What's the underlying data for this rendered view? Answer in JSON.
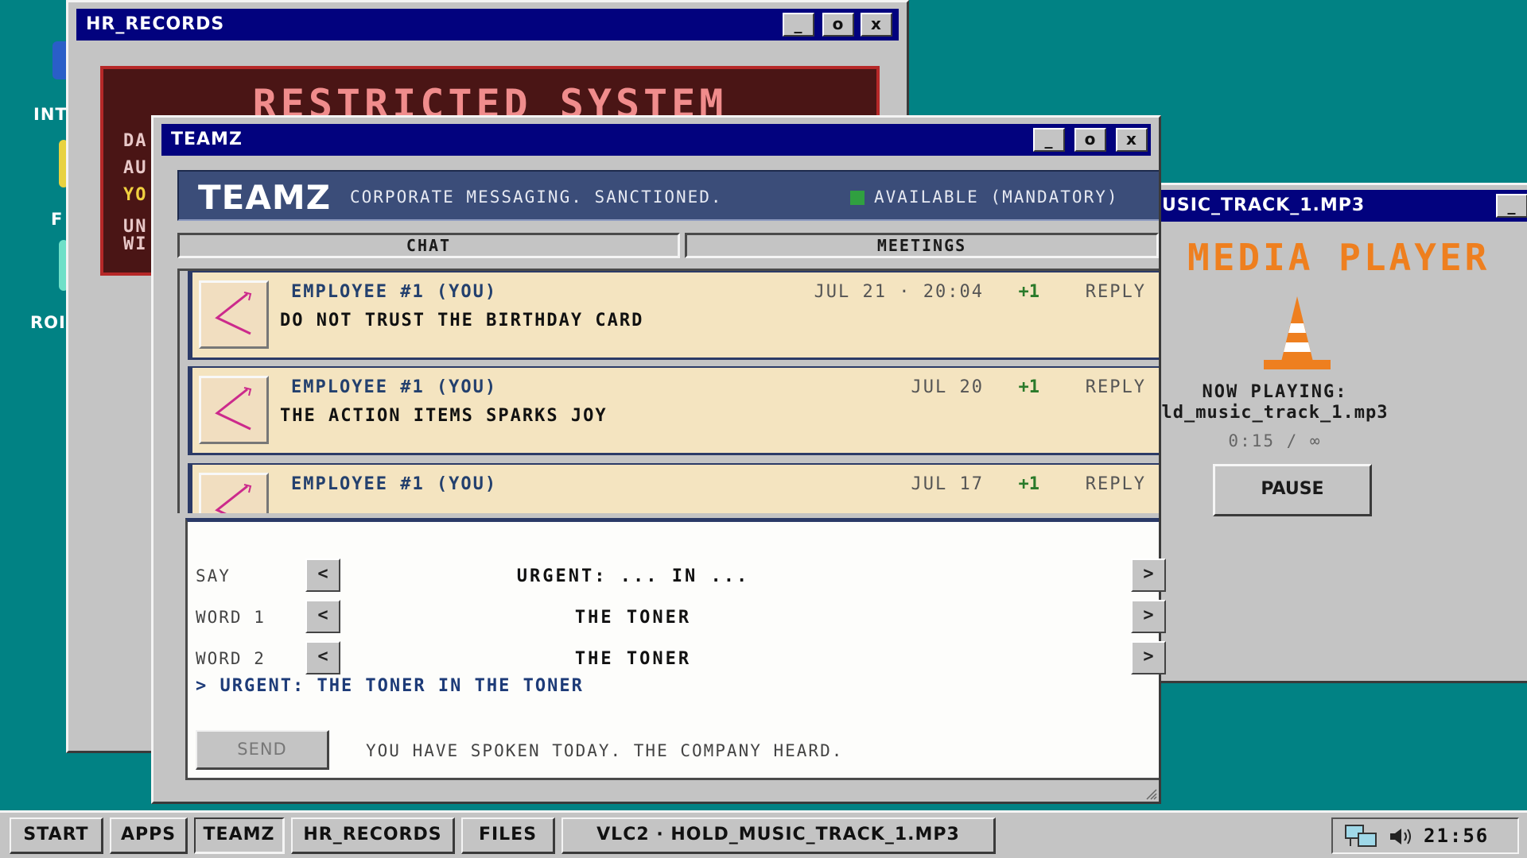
{
  "desktop": {
    "icons": [
      {
        "label": "INT",
        "icon": "internet-icon"
      },
      {
        "label": "F",
        "icon": "folder-icon"
      },
      {
        "label": "ROI",
        "icon": "recycle-bin-icon"
      }
    ]
  },
  "hr_window": {
    "title": "HR_RECORDS",
    "banner": "RESTRICTED SYSTEM",
    "lines": [
      "DA",
      "AU",
      "YO",
      "UN",
      "WI"
    ]
  },
  "teamz_window": {
    "title": "TEAMZ",
    "header": {
      "logo": "TEAMZ",
      "tagline": "CORPORATE MESSAGING. SANCTIONED.",
      "status": "AVAILABLE (MANDATORY)",
      "status_color": "#30a040"
    },
    "tabs": [
      "CHAT",
      "MEETINGS"
    ],
    "messages": [
      {
        "author": "EMPLOYEE #1 (YOU)",
        "time": "JUL 21 · 20:04",
        "likes": "+1",
        "reply": "REPLY",
        "text": "DO NOT TRUST THE BIRTHDAY CARD"
      },
      {
        "author": "EMPLOYEE #1 (YOU)",
        "time": "JUL 20",
        "likes": "+1",
        "reply": "REPLY",
        "text": "THE ACTION ITEMS SPARKS JOY"
      },
      {
        "author": "EMPLOYEE #1 (YOU)",
        "time": "JUL 17",
        "likes": "+1",
        "reply": "REPLY",
        "text": ""
      }
    ],
    "composer": {
      "rows": [
        {
          "label": "SAY",
          "value": "URGENT: ... IN ..."
        },
        {
          "label": "WORD 1",
          "value": "THE TONER"
        },
        {
          "label": "WORD 2",
          "value": "THE TONER"
        }
      ],
      "prev_glyph": "<",
      "next_glyph": ">",
      "preview": "> URGENT: THE TONER IN THE TONER",
      "send_label": "SEND",
      "status": "YOU HAVE SPOKEN TODAY. THE COMPANY HEARD."
    }
  },
  "media_window": {
    "title": "USIC_TRACK_1.MP3",
    "heading": "MEDIA PLAYER",
    "now_playing_label": "NOW PLAYING:",
    "track": "ld_music_track_1.mp3",
    "time": "0:15 / ∞",
    "pause_label": "PAUSE",
    "accent": "#ee7f1f"
  },
  "window_controls": {
    "minimize": "_",
    "maximize": "o",
    "close": "x"
  },
  "taskbar": {
    "buttons": [
      "START",
      "APPS",
      "TEAMZ",
      "HR_RECORDS",
      "FILES",
      "VLC2 · HOLD_MUSIC_TRACK_1.MP3"
    ],
    "clock": "21:56"
  }
}
